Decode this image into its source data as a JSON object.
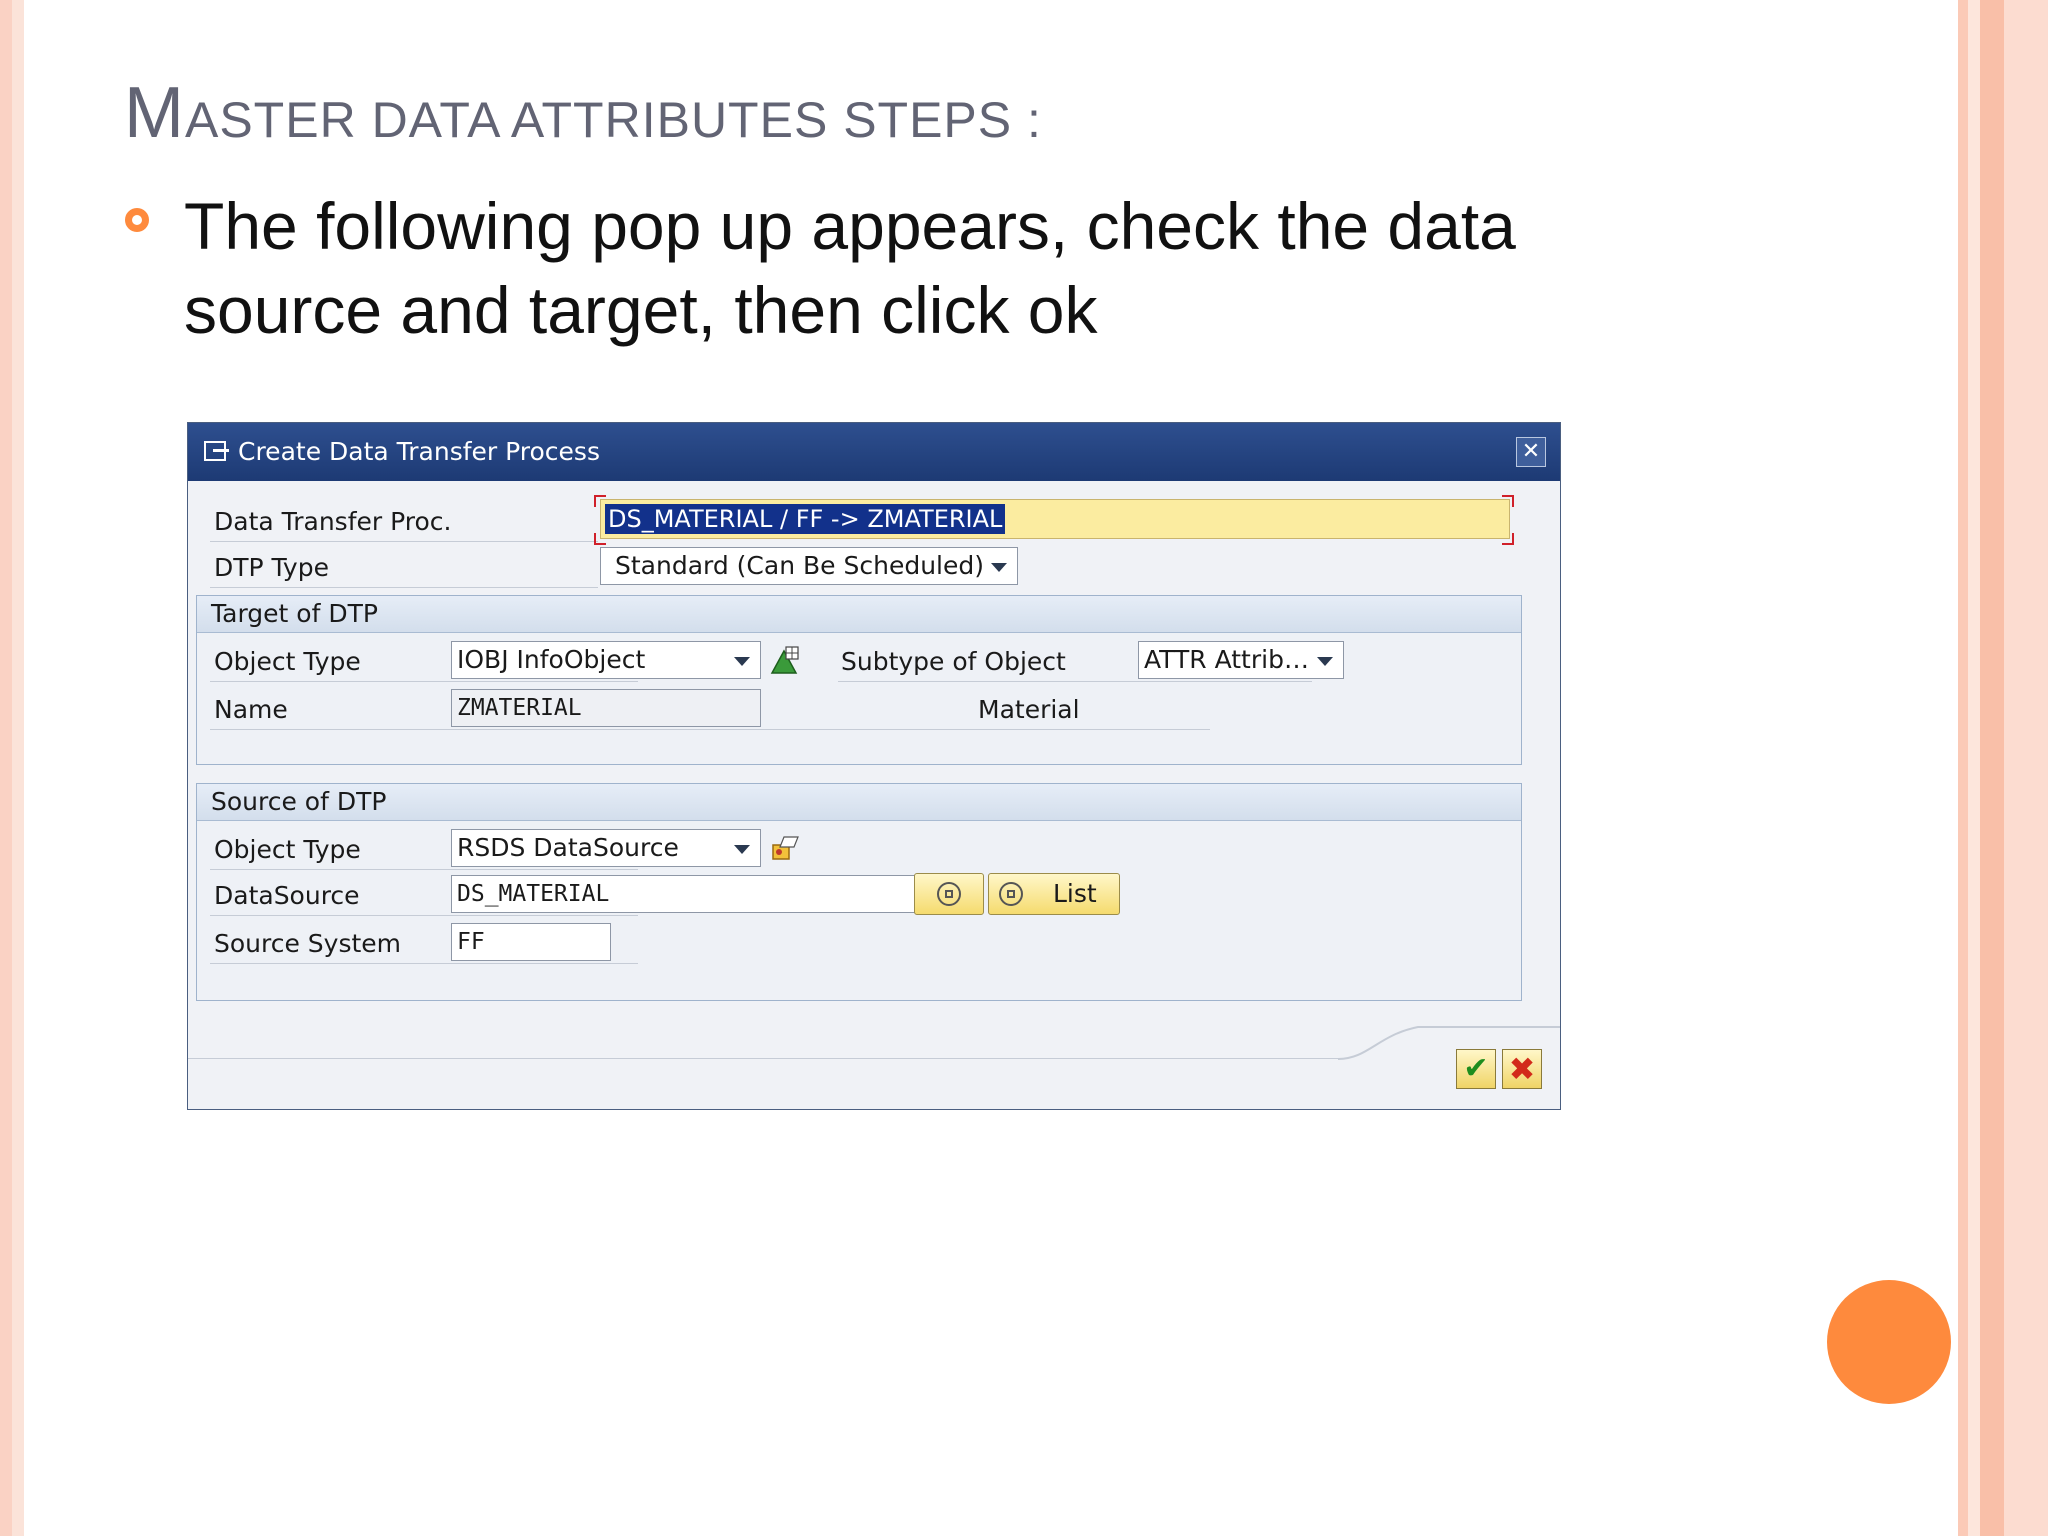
{
  "slide": {
    "title_first_letter": "M",
    "title_rest": "ASTER DATA ATTRIBUTES STEPS :",
    "bullet": "The following pop up appears, check the data source and target, then click ok"
  },
  "dialog": {
    "title": "Create Data Transfer Process",
    "dtp_label": "Data Transfer Proc.",
    "dtp_value": "DS_MATERIAL / FF -> ZMATERIAL",
    "dtp_type_label": "DTP Type",
    "dtp_type_value": "Standard (Can Be Scheduled)",
    "target": {
      "header": "Target of DTP",
      "object_type_label": "Object Type",
      "object_type_value": "IOBJ InfoObject",
      "subtype_label": "Subtype of Object",
      "subtype_value": "ATTR Attrib…",
      "name_label": "Name",
      "name_value": "ZMATERIAL",
      "name_desc": "Material"
    },
    "source": {
      "header": "Source of DTP",
      "object_type_label": "Object Type",
      "object_type_value": "RSDS DataSource",
      "datasource_label": "DataSource",
      "datasource_value": "DS_MATERIAL",
      "list_label": "List",
      "source_system_label": "Source System",
      "source_system_value": "FF"
    },
    "ok_glyph": "✔",
    "cancel_glyph": "✖",
    "close_glyph": "✕"
  },
  "colors": {
    "accent_orange": "#fe8a3d",
    "title_blue": "#1d3a74",
    "highlight_yellow": "#fbeca0"
  }
}
